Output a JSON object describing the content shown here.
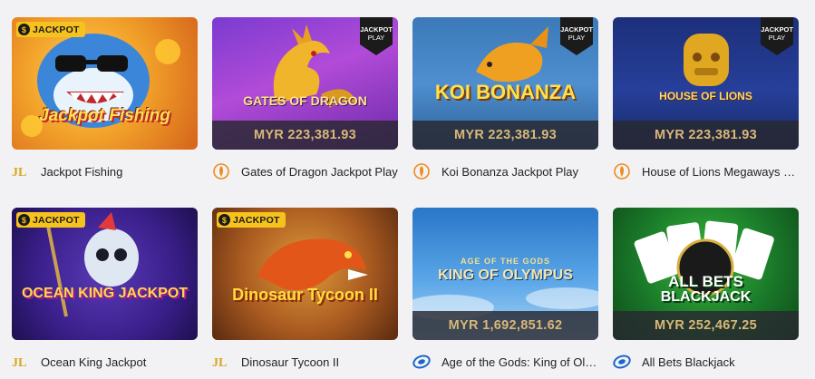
{
  "badges": {
    "jackpot": "JACKPOT",
    "jackpot_play_top": "JACKPOT",
    "jackpot_play_bottom": "PLAY"
  },
  "games": [
    {
      "name": "Jackpot Fishing",
      "provider_icon": "jili-icon",
      "amount": "",
      "art_text": "Jackpot Fishing"
    },
    {
      "name": "Gates of Dragon Jackpot Play",
      "provider_icon": "pragmatic-play-icon",
      "amount": "MYR 223,381.93",
      "art_text": "GATES OF DRAGON"
    },
    {
      "name": "Koi Bonanza Jackpot Play",
      "provider_icon": "pragmatic-play-icon",
      "amount": "MYR 223,381.93",
      "art_text": "KOI BONANZA"
    },
    {
      "name": "House of Lions Megaways Jackpot Play",
      "provider_icon": "pragmatic-play-icon",
      "amount": "MYR 223,381.93",
      "art_text": "HOUSE OF LIONS"
    },
    {
      "name": "Ocean King Jackpot",
      "provider_icon": "jili-icon",
      "amount": "",
      "art_text": "OCEAN KING JACKPOT"
    },
    {
      "name": "Dinosaur Tycoon II",
      "provider_icon": "jili-icon",
      "amount": "",
      "art_text": "Dinosaur Tycoon II"
    },
    {
      "name": "Age of the Gods: King of Olympus",
      "provider_icon": "playtech-icon",
      "amount": "MYR 1,692,851.62",
      "art_text": "KING OF OLYMPUS",
      "art_subtext": "AGE OF THE GODS"
    },
    {
      "name": "All Bets Blackjack",
      "provider_icon": "playtech-icon",
      "amount": "MYR 252,467.25",
      "art_text": "BLACKJACK",
      "art_subtext": "ALL BETS"
    }
  ],
  "colors": {
    "jackpot_badge": "#f6c21e",
    "amount_text": "#d8b878",
    "amount_bar": "#28282f"
  }
}
